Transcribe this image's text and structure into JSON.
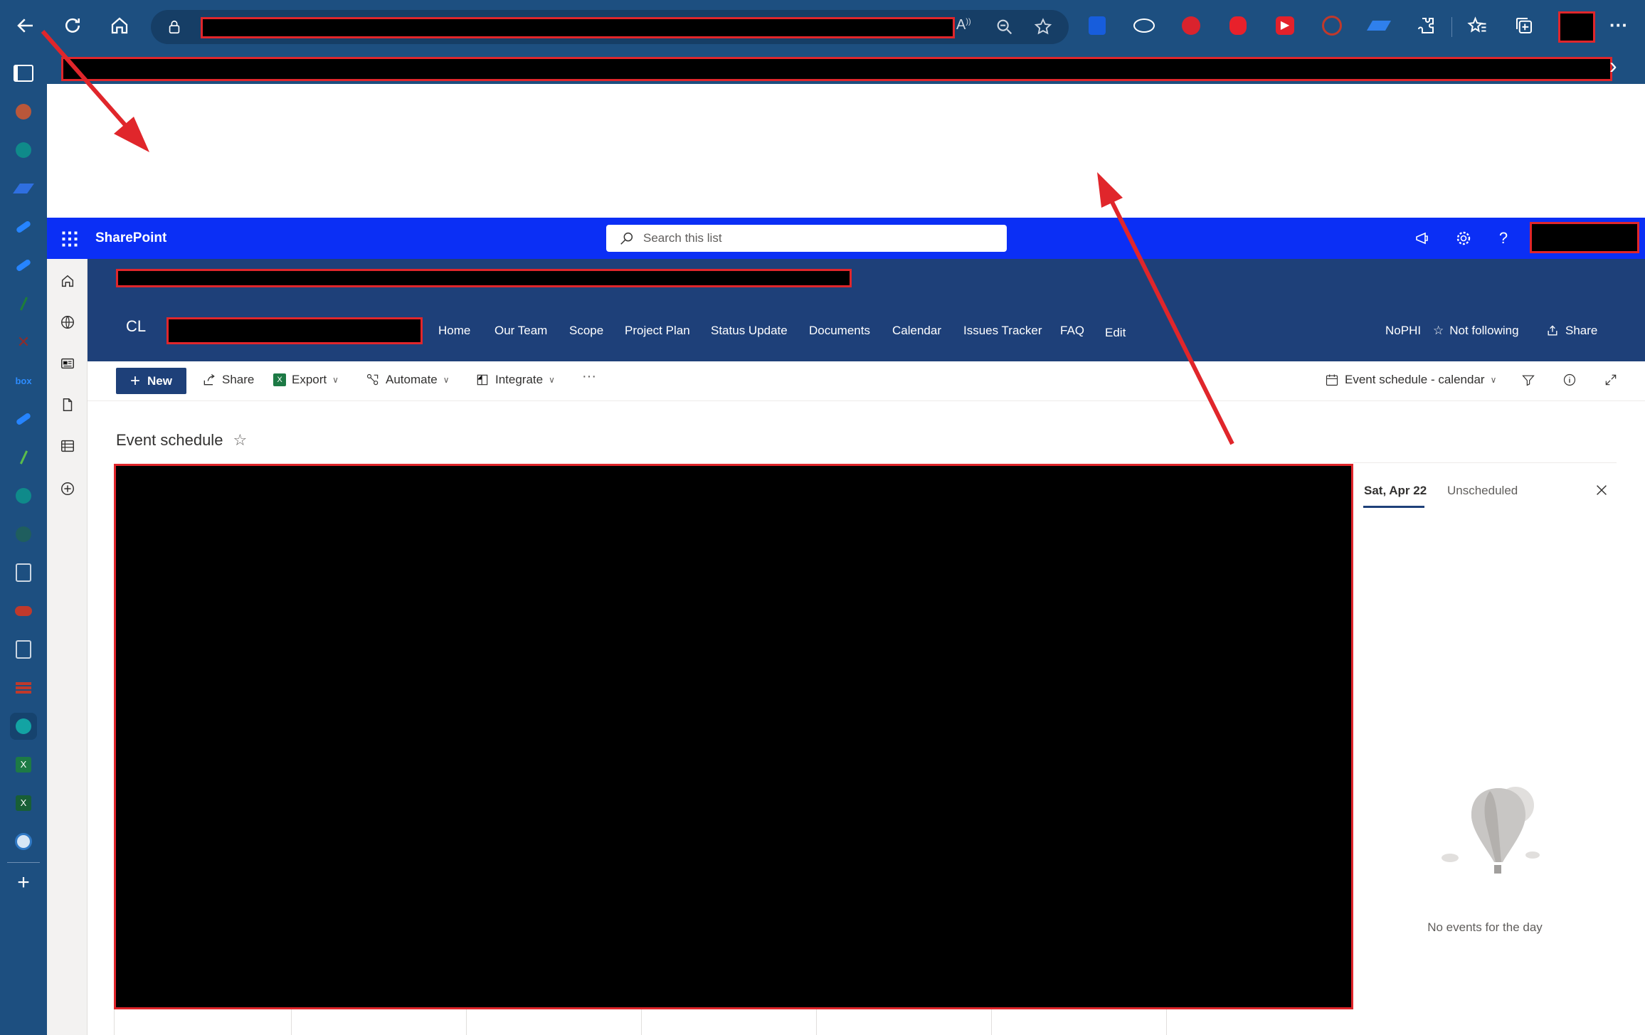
{
  "browser": {
    "toolbar_icons": [
      "back-icon",
      "refresh-icon",
      "home-icon",
      "lock-icon",
      "read-aloud-icon",
      "zoom-icon",
      "add-favorite-icon"
    ],
    "extension_icons": [
      "bitwarden-icon",
      "extension-eye-icon",
      "stop-icon",
      "hand-icon",
      "forward-icon",
      "block-icon",
      "arrow-extension-icon",
      "puzzle-icon",
      "favorites-icon",
      "collections-icon"
    ],
    "more_label": "···",
    "chevron_label": "›"
  },
  "sidebar": {
    "icons": [
      "tabs-icon",
      "app-icon",
      "sharepoint-icon",
      "power-automate-icon",
      "confluence-icon",
      "confluence-icon-2",
      "pen-icon",
      "x-icon",
      "box-icon",
      "confluence-icon-3",
      "pen-icon-2",
      "sharepoint-icon-2",
      "gear-app-icon",
      "search-app-icon",
      "red-app-icon",
      "search-app-icon-2",
      "bricks-icon",
      "sharepoint-active-icon",
      "excel-icon",
      "excel-icon-2",
      "globe-app-icon"
    ],
    "add_label": "+"
  },
  "suitebar": {
    "brand": "SharePoint",
    "search_placeholder": "Search this list"
  },
  "site": {
    "initials": "CL",
    "nav": [
      "Home",
      "Our Team",
      "Scope",
      "Project Plan",
      "Status Update",
      "Documents",
      "Calendar",
      "Issues Tracker",
      "FAQ",
      "Edit"
    ],
    "sensitivity": "NoPHI",
    "follow_label": "Not following",
    "share_label": "Share"
  },
  "commands": {
    "new_label": "New",
    "share_label": "Share",
    "export_label": "Export",
    "automate_label": "Automate",
    "integrate_label": "Integrate",
    "more_label": "···",
    "view_label": "Event schedule - calendar"
  },
  "list": {
    "title": "Event schedule"
  },
  "panel": {
    "tab_day": "Sat, Apr 22",
    "tab_unscheduled": "Unscheduled",
    "empty_message": "No events for the day"
  },
  "colors": {
    "browser_chrome": "#1d4f80",
    "suitebar": "#0b2ff5",
    "site_header": "#1e4079",
    "annotation": "#e0262b"
  }
}
